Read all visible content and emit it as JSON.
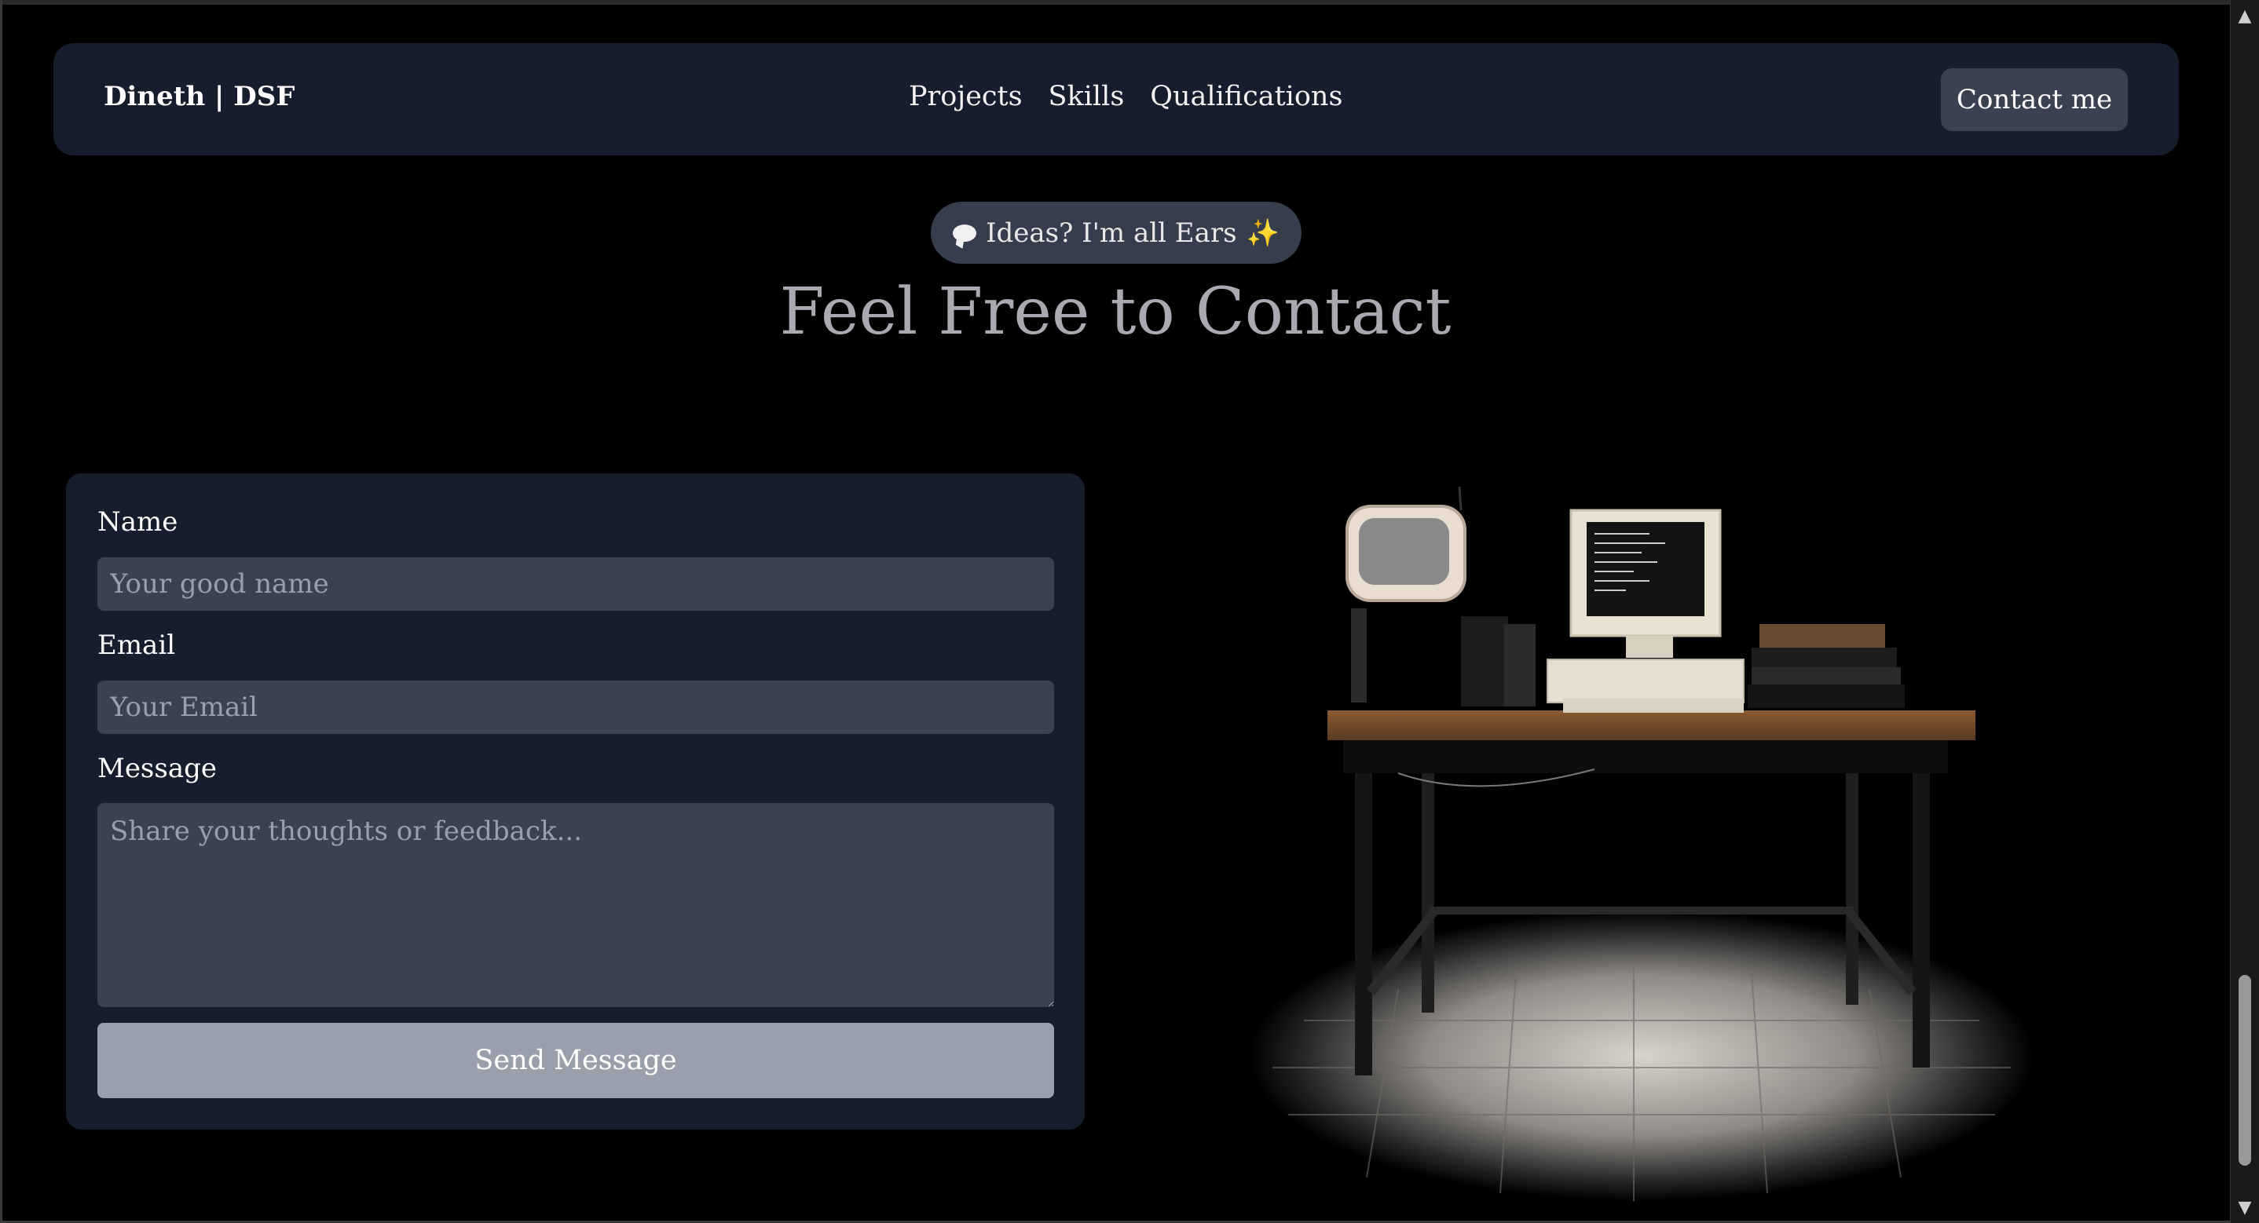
{
  "navbar": {
    "brand": "Dineth | DSF",
    "links": [
      "Projects",
      "Skills",
      "Qualifications"
    ],
    "contact_button": "Contact me"
  },
  "hero": {
    "badge_text": "Ideas? I'm all Ears",
    "badge_icon_left": "speech-bubble-icon",
    "badge_icon_right": "sparkles-icon",
    "title": "Feel Free to Contact"
  },
  "form": {
    "name_label": "Name",
    "name_placeholder": "Your good name",
    "email_label": "Email",
    "email_placeholder": "Your Email",
    "message_label": "Message",
    "message_placeholder": "Share your thoughts or feedback...",
    "submit_label": "Send Message"
  },
  "scene": {
    "description_icon": "retro-desk-3d-icon"
  },
  "colors": {
    "background": "#000000",
    "card": "#161d2c",
    "input": "#3a4150",
    "button": "#9aa0ab",
    "title": "#a9a9b2"
  }
}
